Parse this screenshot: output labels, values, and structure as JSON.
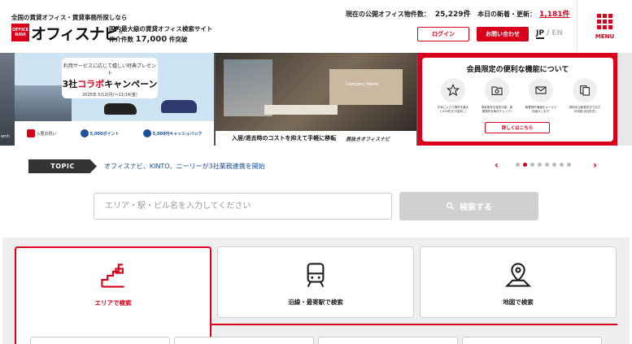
{
  "header": {
    "tagline": "全国の賃貸オフィス・賃貸事務所探しなら",
    "logo_badge_top": "OFFICE",
    "logo_badge_bottom": "NAVI",
    "logo_text": "オフィスナビ",
    "subtitle": "国内最大級の賃貸オフィス検索サイト",
    "brokers_label": "仲介件数",
    "brokers_count": "17,000",
    "brokers_suffix": "件突破",
    "listing_label": "現在の公開オフィス物件数：",
    "listing_count": "25,229件",
    "new_label": "本日の新着・更新：",
    "new_count": "1,181件",
    "login_label": "ログイン",
    "contact_label": "お問い合わせ",
    "lang_jp": "JP",
    "lang_sep": "/",
    "lang_en": "EN",
    "menu_label": "MENU"
  },
  "banners": {
    "edge_left_text": "arch",
    "banner1": {
      "sub": "利用サービスに応じて嬉しい特典プレゼント",
      "main_pre": "3社",
      "main_red": "コラボ",
      "main_post": "キャンペーン",
      "date": "2025年 5/12(月)〜11/14(金)",
      "foot1": "入居お祝い",
      "foot2": "5,000ポイント",
      "foot3": "5,000円キャッシュバック"
    },
    "banner2": {
      "sign": "Company Name",
      "text": "入居/退去時のコストを抑えて手軽に移転",
      "brand": "居抜きオフィスナビ"
    },
    "banner3": {
      "title": "会員限定の便利な機能について",
      "features": [
        "お気に入りで物件を最大1,000件まで保存に!",
        "検索条件を保存可能、新着物件を毎日チェック!",
        "新着物件情報をメールでお届けします!",
        "資料を比較表形式で出力が可能(当社形式)"
      ],
      "button": "詳しくはこちら"
    }
  },
  "topic": {
    "tag": "TOPIC",
    "text": "オフィスナビ、KINTO、ニーリーが3社業務連携を開始",
    "prev": "‹",
    "next": "›",
    "dots_total": 8,
    "dots_active": 2
  },
  "search": {
    "placeholder": "エリア・駅・ビル名を入力してください",
    "button": "検索する"
  },
  "search_modes": [
    {
      "label": "エリアで検索",
      "icon": "area-map-icon",
      "active": true
    },
    {
      "label": "沿線・最寄駅で検索",
      "icon": "train-icon",
      "active": false
    },
    {
      "label": "地図で検索",
      "icon": "map-pin-icon",
      "active": false
    }
  ],
  "colors": {
    "brand_red": "#d9001b",
    "topic_link": "#1a4f9c",
    "search_button": "#d0d0d0"
  }
}
